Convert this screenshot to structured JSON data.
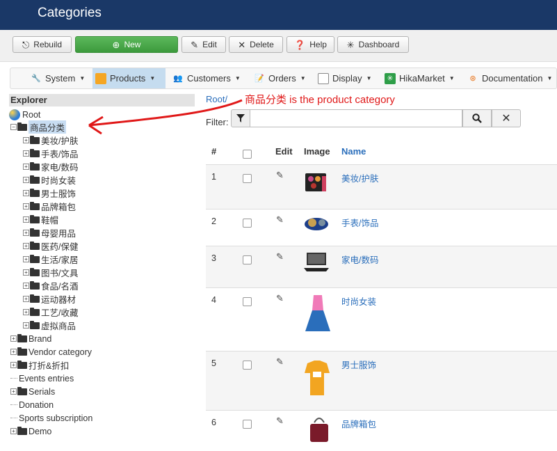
{
  "header": {
    "title": "Categories"
  },
  "toolbar": {
    "rebuild": "Rebuild",
    "new": "New",
    "edit": "Edit",
    "delete": "Delete",
    "help": "Help",
    "dashboard": "Dashboard"
  },
  "menu": {
    "items": [
      {
        "label": "System"
      },
      {
        "label": "Products"
      },
      {
        "label": "Customers"
      },
      {
        "label": "Orders"
      },
      {
        "label": "Display"
      },
      {
        "label": "HikaMarket"
      },
      {
        "label": "Documentation"
      }
    ]
  },
  "explorer": {
    "title": "Explorer",
    "root": "Root",
    "selected": "商品分类",
    "children": [
      "美妆/护肤",
      "手表/饰品",
      "家电/数码",
      "时尚女装",
      "男士服饰",
      "品牌箱包",
      "鞋帽",
      "母婴用品",
      "医药/保健",
      "生活/家居",
      "图书/文具",
      "食品/名酒",
      "运动器材",
      "工艺/收藏",
      "虚拟商品"
    ],
    "others": [
      "Brand",
      "Vendor category",
      "打折&折扣",
      "Events entries",
      "Serials",
      "Donation",
      "Sports subscription",
      "Demo"
    ]
  },
  "annotation": "商品分类 is the product category",
  "breadcrumb": "Root/",
  "filter": {
    "label": "Filter:",
    "value": ""
  },
  "table": {
    "headers": {
      "num": "#",
      "edit": "Edit",
      "image": "Image",
      "name": "Name"
    },
    "rows": [
      {
        "num": "1",
        "name": "美妆/护肤"
      },
      {
        "num": "2",
        "name": "手表/饰品"
      },
      {
        "num": "3",
        "name": "家电/数码"
      },
      {
        "num": "4",
        "name": "时尚女装"
      },
      {
        "num": "5",
        "name": "男士服饰"
      },
      {
        "num": "6",
        "name": "品牌箱包"
      }
    ]
  },
  "colors": {
    "header": "#1a3867",
    "link": "#2a6ebb",
    "annotation": "#e01818",
    "new_button": "#4cae4c"
  }
}
